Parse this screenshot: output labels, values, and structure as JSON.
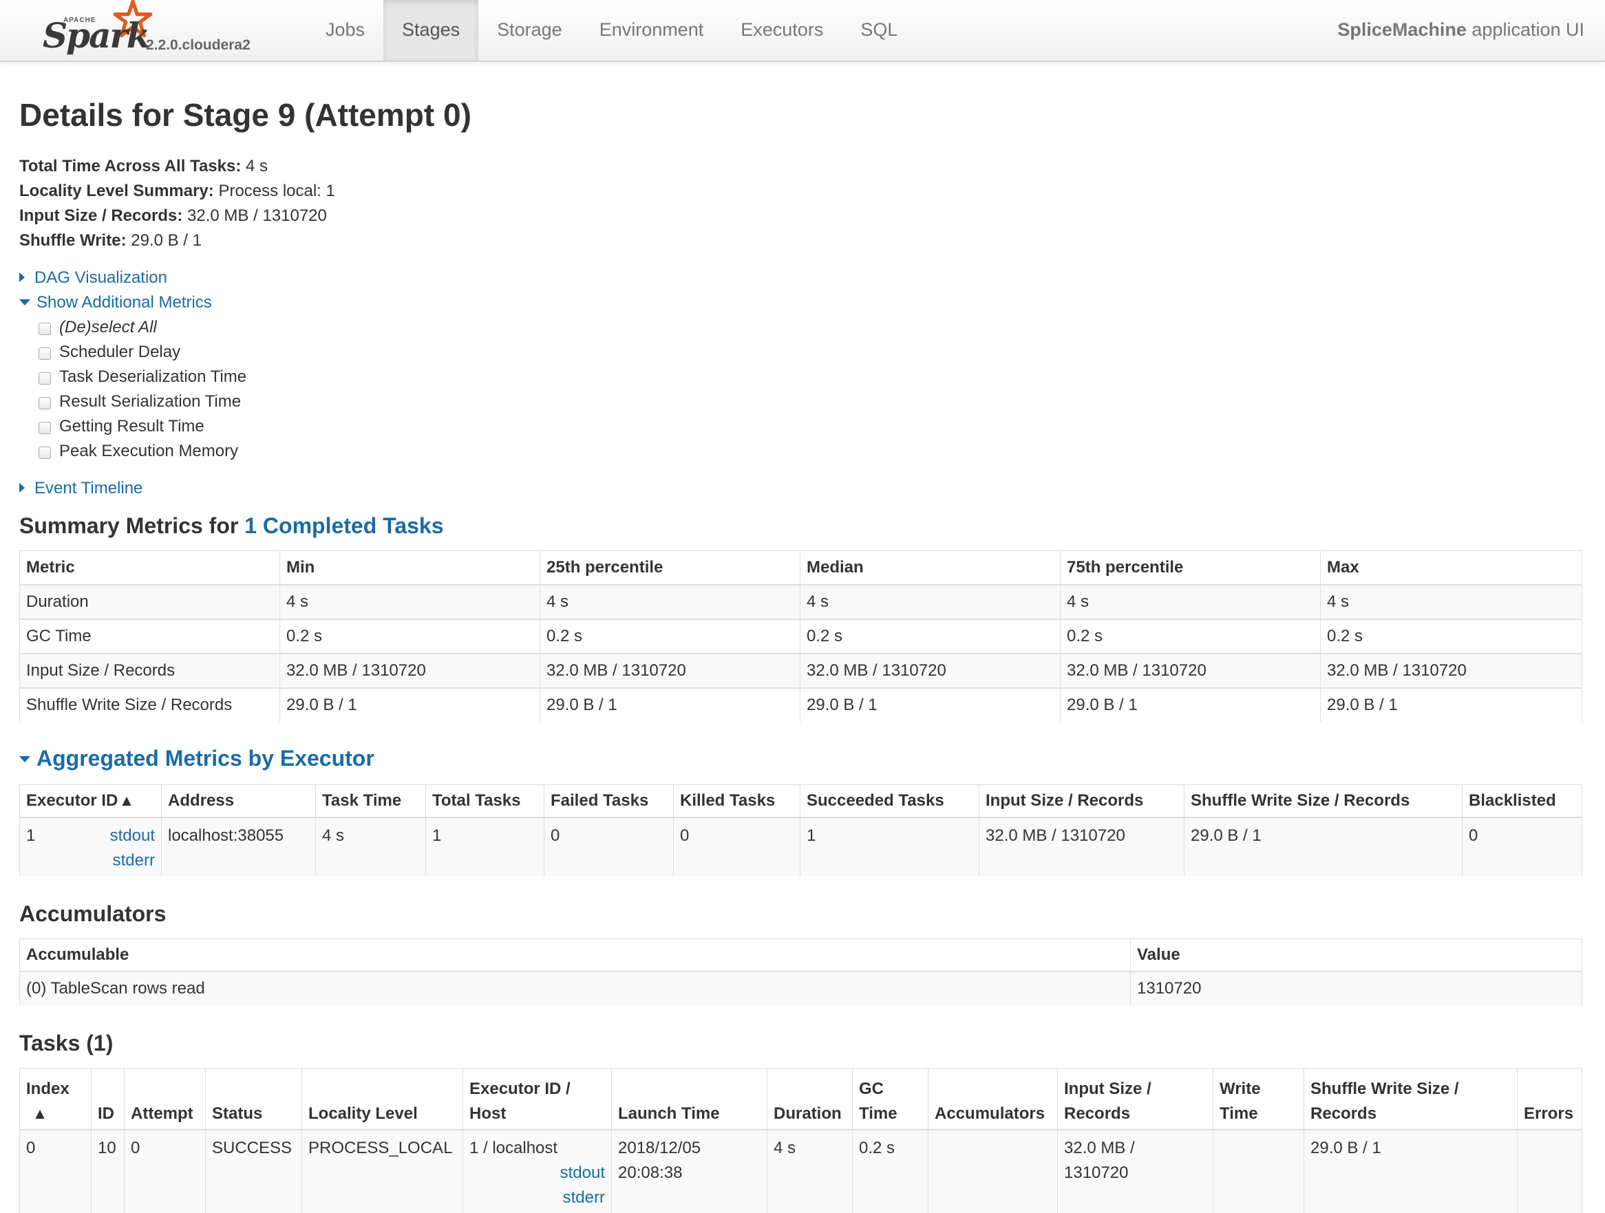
{
  "navbar": {
    "brand_apache": "APACHE",
    "brand_name": "Spark",
    "version": "2.2.0.cloudera2",
    "tabs": [
      {
        "label": "Jobs",
        "active": false
      },
      {
        "label": "Stages",
        "active": true
      },
      {
        "label": "Storage",
        "active": false
      },
      {
        "label": "Environment",
        "active": false
      },
      {
        "label": "Executors",
        "active": false
      },
      {
        "label": "SQL",
        "active": false
      }
    ],
    "app_name": "SpliceMachine",
    "app_suffix": " application UI"
  },
  "page": {
    "title": "Details for Stage 9 (Attempt 0)",
    "summary": [
      {
        "label": "Total Time Across All Tasks:",
        "value": " 4 s"
      },
      {
        "label": "Locality Level Summary:",
        "value": " Process local: 1"
      },
      {
        "label": "Input Size / Records:",
        "value": " 32.0 MB / 1310720"
      },
      {
        "label": "Shuffle Write:",
        "value": " 29.0 B / 1"
      }
    ],
    "dag_toggle": "DAG Visualization",
    "metrics_toggle": "Show Additional Metrics",
    "metric_options": [
      "(De)select All",
      "Scheduler Delay",
      "Task Deserialization Time",
      "Result Serialization Time",
      "Getting Result Time",
      "Peak Execution Memory"
    ],
    "timeline_toggle": "Event Timeline"
  },
  "summary_metrics": {
    "title_prefix": "Summary Metrics for ",
    "title_link": "1 Completed Tasks",
    "headers": [
      "Metric",
      "Min",
      "25th percentile",
      "Median",
      "75th percentile",
      "Max"
    ],
    "rows": [
      [
        "Duration",
        "4 s",
        "4 s",
        "4 s",
        "4 s",
        "4 s"
      ],
      [
        "GC Time",
        "0.2 s",
        "0.2 s",
        "0.2 s",
        "0.2 s",
        "0.2 s"
      ],
      [
        "Input Size / Records",
        "32.0 MB / 1310720",
        "32.0 MB / 1310720",
        "32.0 MB / 1310720",
        "32.0 MB / 1310720",
        "32.0 MB / 1310720"
      ],
      [
        "Shuffle Write Size / Records",
        "29.0 B / 1",
        "29.0 B / 1",
        "29.0 B / 1",
        "29.0 B / 1",
        "29.0 B / 1"
      ]
    ]
  },
  "executor_metrics": {
    "title": "Aggregated Metrics by Executor",
    "headers": [
      "Executor ID ▴",
      "Address",
      "Task Time",
      "Total Tasks",
      "Failed Tasks",
      "Killed Tasks",
      "Succeeded Tasks",
      "Input Size / Records",
      "Shuffle Write Size / Records",
      "Blacklisted"
    ],
    "row": {
      "executor_id": "1",
      "stdout": "stdout",
      "stderr": "stderr",
      "address": "localhost:38055",
      "task_time": "4 s",
      "total_tasks": "1",
      "failed_tasks": "0",
      "killed_tasks": "0",
      "succeeded_tasks": "1",
      "input": "32.0 MB / 1310720",
      "shuffle_write": "29.0 B / 1",
      "blacklisted": "0"
    }
  },
  "accumulators": {
    "title": "Accumulators",
    "headers": [
      "Accumulable",
      "Value"
    ],
    "row": {
      "name": "(0) TableScan rows read",
      "value": "1310720"
    }
  },
  "tasks": {
    "title": "Tasks (1)",
    "headers": {
      "index_line1": "Index",
      "index_line2": "▴",
      "id": "ID",
      "attempt": "Attempt",
      "status": "Status",
      "locality": "Locality Level",
      "executor_line1": "Executor ID /",
      "executor_line2": "Host",
      "launch_time": "Launch Time",
      "duration": "Duration",
      "gc_line1": "GC",
      "gc_line2": "Time",
      "accumulators": "Accumulators",
      "input_line1": "Input Size /",
      "input_line2": "Records",
      "write_line1": "Write",
      "write_line2": "Time",
      "shuffle_line1": "Shuffle Write Size /",
      "shuffle_line2": "Records",
      "errors": "Errors"
    },
    "row": {
      "index": "0",
      "id": "10",
      "attempt": "0",
      "status": "SUCCESS",
      "locality": "PROCESS_LOCAL",
      "executor_host": "1 / localhost",
      "stdout": "stdout",
      "stderr": "stderr",
      "launch_date": "2018/12/05",
      "launch_time": "20:08:38",
      "duration": "4 s",
      "gc_time": "0.2 s",
      "accumulators": "",
      "input_line1": "32.0 MB /",
      "input_line2": "1310720",
      "write_time": "",
      "shuffle_write": "29.0 B / 1",
      "errors": ""
    }
  }
}
